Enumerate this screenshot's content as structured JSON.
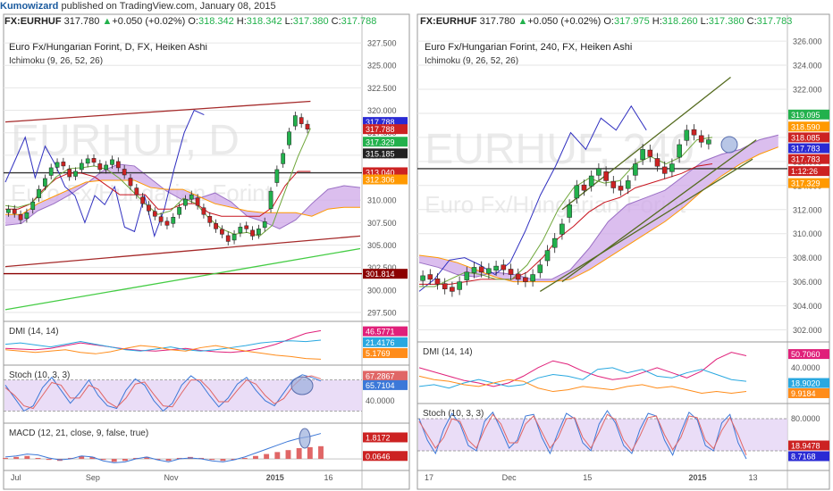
{
  "header": {
    "author": "Kumowizard",
    "published_text": "published on TradingView.com, January 08, 2015"
  },
  "colors": {
    "up": "#22b14c",
    "down": "#cc2222",
    "grid": "#e6e6e6",
    "cloud": "#cfa8e8",
    "tenkan": "#2a2ad4",
    "kijun": "#c8141e",
    "chikou": "#3030c0",
    "span_b": "#ff9900",
    "channel_dark": "#a52a2a",
    "channel_olive": "#556b1f",
    "channel_green": "#44cc44",
    "dmi_plus": "#29a8e0",
    "dmi_minus": "#ff8c1a",
    "adx": "#e0207a",
    "stoch_k": "#3c78d8",
    "stoch_d": "#e06666",
    "stoch_band": "#e5d5f5",
    "macd_hist": "#e06666",
    "macd_line": "#3c78d8",
    "highlight_circle": "#9aaedc"
  },
  "chart_data": [
    {
      "type": "candlestick",
      "panel": "left",
      "symbol": "FX:EURHUF",
      "ohlc_line": {
        "last": "317.780",
        "change": "+0.050 (+0.02%)",
        "O": "318.342",
        "H": "318.342",
        "L": "317.380",
        "C": "317.788"
      },
      "title": "Euro Fx/Hungarian Forint, D, FX, Heiken Ashi",
      "indicator": "Ichimoku (9, 26, 52, 26)",
      "watermark": "EURHUF, D",
      "watermark_sub": "Euro Fx/Hungarian Forint",
      "y_ticks": [
        "327.500",
        "325.000",
        "322.500",
        "320.000",
        "317.500",
        "315.000",
        "312.500",
        "310.000",
        "307.500",
        "305.000",
        "302.500",
        "300.000",
        "297.500"
      ],
      "ylim": [
        296.5,
        328.5
      ],
      "x_ticks": [
        "Jul",
        "Sep",
        "Nov",
        "2015",
        "16"
      ],
      "price_labels": [
        {
          "text": "317.788",
          "value": 318.7,
          "color": "#2a2ad4"
        },
        {
          "text": "317.788",
          "value": 317.9,
          "color": "#cc2222"
        },
        {
          "text": "317.329",
          "value": 316.5,
          "color": "#22b14c"
        },
        {
          "text": "315.185",
          "value": 315.2,
          "color": "#222222"
        },
        {
          "text": "313.040",
          "value": 313.1,
          "color": "#cc2222"
        },
        {
          "text": "312.306",
          "value": 312.3,
          "color": "#ff9900"
        },
        {
          "text": "301.814",
          "value": 301.8,
          "color": "#8b0000"
        }
      ],
      "horizontal_lines": [
        {
          "value": 313.04,
          "color": "#333333"
        },
        {
          "value": 301.81,
          "color": "#8b0000"
        }
      ],
      "channel_lines": [
        {
          "x1": 0.0,
          "y1": 318.7,
          "x2": 0.86,
          "y2": 321.0,
          "color": "#a52a2a"
        },
        {
          "x1": 0.0,
          "y1": 302.6,
          "x2": 1.0,
          "y2": 306.0,
          "color": "#a52a2a"
        },
        {
          "x1": 0.0,
          "y1": 297.8,
          "x2": 1.0,
          "y2": 304.6,
          "color": "#44cc44"
        }
      ],
      "close_series": [
        309,
        308.5,
        307.8,
        308.6,
        309.8,
        311.2,
        312.4,
        313.6,
        314.2,
        313.8,
        312.6,
        313.2,
        314.1,
        314.6,
        314.2,
        313.4,
        313.9,
        314.5,
        313.6,
        312.8,
        311.6,
        310.6,
        309.6,
        308.8,
        308.2,
        307.6,
        307.2,
        308.1,
        309.2,
        310.1,
        310.6,
        309.4,
        308.4,
        307.5,
        306.8,
        306.2,
        305.4,
        306.2,
        307.0,
        306.8,
        306.0,
        306.8,
        307.6,
        311.0,
        313.4,
        315.2,
        317.6,
        319.4,
        318.5,
        317.9
      ],
      "x_end": 0.86,
      "tenkan": [
        309.4,
        309.2,
        309.6,
        311.0,
        312.6,
        313.5,
        313.6,
        313.8,
        313.4,
        312.4,
        311.0,
        309.6,
        308.4,
        308.8,
        310.2,
        309.6,
        308.0,
        306.8,
        306.2,
        306.4,
        306.0,
        307.2,
        311.0,
        314.8,
        318.0
      ],
      "kijun": [
        309.0,
        309.0,
        309.6,
        311.2,
        312.4,
        313.0,
        313.0,
        312.6,
        311.6,
        310.6,
        310.6,
        310.6,
        309.0,
        309.0,
        309.6,
        309.6,
        308.6,
        308.2,
        308.2,
        308.2,
        308.2,
        309.2,
        311.6,
        313.2,
        313.2
      ],
      "chikou": [
        312.0,
        314.5,
        317.0,
        312.5,
        316.0,
        314.0,
        311.5,
        310.5,
        307.5,
        310.5,
        309.5,
        311.5,
        307.0,
        306.5,
        310.5,
        306.0,
        309.0,
        313.5,
        317.5,
        320.0,
        319.5
      ],
      "chikou_x_end": 0.56,
      "cloud_a": [
        307.2,
        307.4,
        308.8,
        309.6,
        310.6,
        311.8,
        313.2,
        314.0,
        313.8,
        312.4,
        311.0,
        310.0,
        310.2,
        310.8,
        309.8,
        308.2,
        307.6,
        306.8,
        307.8,
        309.6,
        311.2,
        311.6,
        311.4
      ],
      "cloud_b": [
        308.4,
        308.4,
        309.6,
        310.4,
        311.2,
        312.0,
        312.2,
        312.2,
        312.2,
        311.4,
        311.2,
        311.2,
        310.4,
        309.6,
        309.2,
        308.8,
        308.6,
        308.6,
        308.6,
        308.2,
        309.0,
        309.2,
        309.2
      ],
      "cloud_x_start": 0.0,
      "cloud_x_end": 1.0
    },
    {
      "type": "line",
      "panel": "left",
      "title": "DMI (14, 14)",
      "series": [
        {
          "name": "ADX",
          "values": [
            22,
            21,
            20,
            22,
            26,
            30,
            27,
            24,
            21,
            19,
            18,
            20,
            22,
            19,
            17,
            16,
            18,
            22,
            28,
            36,
            44,
            48
          ],
          "color": "#e0207a"
        },
        {
          "name": "+DI",
          "values": [
            28,
            30,
            27,
            24,
            28,
            32,
            28,
            24,
            20,
            18,
            21,
            24,
            20,
            18,
            20,
            23,
            26,
            30,
            32,
            33,
            32,
            34
          ],
          "color": "#29a8e0"
        },
        {
          "name": "-DI",
          "values": [
            20,
            18,
            16,
            18,
            20,
            16,
            14,
            17,
            22,
            26,
            24,
            20,
            18,
            23,
            26,
            22,
            18,
            15,
            12,
            10,
            7,
            6
          ],
          "color": "#ff8c1a"
        }
      ],
      "ylim": [
        0,
        55
      ],
      "value_labels": [
        {
          "text": "46.5771",
          "value": 47,
          "color": "#e0207a"
        },
        {
          "text": "21.4176",
          "value": 31,
          "color": "#29a8e0"
        },
        {
          "text": "5.1769",
          "value": 15,
          "color": "#ff8c1a"
        }
      ]
    },
    {
      "type": "line",
      "panel": "left",
      "title": "Stoch (10, 3, 3)",
      "y_ticks": [
        "40.0000"
      ],
      "series": [
        {
          "name": "%K",
          "values": [
            70,
            45,
            20,
            30,
            65,
            85,
            60,
            35,
            55,
            80,
            50,
            30,
            25,
            60,
            82,
            70,
            40,
            20,
            35,
            70,
            88,
            75,
            50,
            28,
            45,
            72,
            85,
            60,
            40,
            30,
            55,
            80,
            90,
            85,
            78
          ],
          "color": "#3c78d8"
        },
        {
          "name": "%D",
          "values": [
            65,
            50,
            30,
            25,
            50,
            75,
            70,
            45,
            45,
            70,
            62,
            38,
            27,
            45,
            72,
            76,
            52,
            30,
            28,
            55,
            80,
            80,
            62,
            38,
            38,
            60,
            80,
            72,
            50,
            34,
            44,
            68,
            85,
            88,
            82
          ],
          "color": "#e06666"
        }
      ],
      "ylim": [
        0,
        100
      ],
      "band": [
        20,
        80
      ],
      "value_labels": [
        {
          "text": "67.2867",
          "value": 88,
          "color": "#e06666"
        },
        {
          "text": "65.7104",
          "value": 70,
          "color": "#3c78d8"
        }
      ]
    },
    {
      "type": "bar",
      "panel": "left",
      "title": "MACD (12, 21, close, 9, false, true)",
      "histogram": [
        0.1,
        0.2,
        0.3,
        0.1,
        -0.1,
        -0.2,
        0.1,
        0.3,
        0.2,
        -0.1,
        -0.3,
        -0.2,
        0.1,
        0.2,
        -0.1,
        -0.2,
        0.1,
        0.2,
        0.1,
        -0.1,
        -0.2,
        -0.1,
        0.1,
        0.3,
        0.5,
        0.7,
        0.9,
        1.1,
        1.2,
        1.3
      ],
      "macd": [
        0.2,
        0.3,
        0.5,
        0.4,
        0.1,
        -0.1,
        0.0,
        0.3,
        0.2,
        -0.2,
        -0.4,
        -0.3,
        0.0,
        0.2,
        -0.1,
        -0.3,
        0.0,
        0.1,
        0.0,
        -0.2,
        -0.3,
        -0.1,
        0.2,
        0.6,
        1.0,
        1.4,
        1.8,
        2.1,
        2.3,
        2.6
      ],
      "ylim": [
        -1.0,
        3.2
      ],
      "value_labels": [
        {
          "text": "1.8172",
          "value": 2.2,
          "color": "#cc2222"
        },
        {
          "text": "0.0646",
          "value": 0.3,
          "color": "#cc2222"
        }
      ]
    },
    {
      "type": "candlestick",
      "panel": "right",
      "symbol": "FX:EURHUF",
      "ohlc_line": {
        "last": "317.780",
        "change": "+0.050 (+0.02%)",
        "O": "317.975",
        "H": "318.260",
        "L": "317.380",
        "C": "317.783"
      },
      "title": "Euro Fx/Hungarian Forint, 240, FX, Heiken Ashi",
      "indicator": "Ichimoku (9, 26, 52, 26)",
      "watermark": "EURHUF, 240",
      "watermark_sub": "Euro Fx/Hungarian Forint",
      "y_ticks": [
        "326.000",
        "324.000",
        "322.000",
        "320.000",
        "318.000",
        "316.000",
        "314.000",
        "312.000",
        "310.000",
        "308.000",
        "306.000",
        "304.000",
        "302.000"
      ],
      "ylim": [
        301.0,
        326.6
      ],
      "x_ticks": [
        "17",
        "Dec",
        "15",
        "2015",
        "13"
      ],
      "price_labels": [
        {
          "text": "319.095",
          "value": 319.9,
          "color": "#22b14c"
        },
        {
          "text": "318.590",
          "value": 318.9,
          "color": "#ff9900"
        },
        {
          "text": "318.085",
          "value": 318.0,
          "color": "#cc2222"
        },
        {
          "text": "317.783",
          "value": 317.1,
          "color": "#2a2ad4"
        },
        {
          "text": "317.783",
          "value": 316.2,
          "color": "#cc2222"
        },
        {
          "text": "1:12:26",
          "value": 315.2,
          "color": "#cc2222"
        },
        {
          "text": "317.329",
          "value": 314.2,
          "color": "#ff9900"
        }
      ],
      "horizontal_lines": [
        {
          "value": 315.4,
          "color": "#333333"
        }
      ],
      "channel_lines": [
        {
          "x1": 0.39,
          "y1": 312.0,
          "x2": 0.85,
          "y2": 323.0,
          "color": "#556b1f"
        },
        {
          "x1": 0.39,
          "y1": 306.0,
          "x2": 0.92,
          "y2": 317.8,
          "color": "#556b1f"
        },
        {
          "x1": 0.33,
          "y1": 305.2,
          "x2": 0.91,
          "y2": 316.2,
          "color": "#556b1f"
        }
      ],
      "close_series": [
        306.5,
        306.2,
        305.8,
        305.4,
        305.2,
        306.0,
        306.8,
        307.2,
        306.8,
        307.1,
        307.3,
        307.0,
        306.6,
        306.2,
        306.0,
        306.6,
        307.4,
        308.6,
        309.6,
        310.8,
        312.4,
        314.0,
        313.6,
        314.8,
        315.4,
        314.4,
        313.8,
        313.6,
        314.4,
        315.8,
        317.0,
        316.4,
        315.6,
        315.0,
        315.8,
        317.4,
        318.6,
        318.2,
        317.6,
        317.8
      ],
      "x_end": 0.8,
      "tenkan": [
        305.6,
        305.6,
        306.2,
        306.8,
        306.6,
        306.2,
        306.2,
        307.4,
        309.4,
        312.0,
        313.8,
        314.6,
        314.2,
        314.4,
        315.8,
        316.4,
        315.8,
        316.4,
        317.8,
        318.0
      ],
      "kijun": [
        305.8,
        305.8,
        305.8,
        306.0,
        306.2,
        306.2,
        306.2,
        306.8,
        308.0,
        309.6,
        310.6,
        311.8,
        312.6,
        313.0,
        313.8,
        314.2,
        314.6,
        315.0,
        315.6,
        315.8
      ],
      "chikou": [
        305.2,
        306.2,
        307.8,
        308.0,
        307.4,
        306.6,
        307.6,
        310.2,
        313.2,
        315.6,
        318.4,
        317.0,
        319.6,
        318.6,
        320.6,
        318.6
      ],
      "chikou_x_end": 0.62,
      "cloud_a": [
        307.6,
        307.2,
        306.6,
        306.4,
        306.8,
        306.6,
        306.2,
        306.2,
        307.0,
        308.8,
        311.0,
        312.4,
        313.0,
        313.6,
        314.8,
        316.0,
        316.6,
        317.0,
        317.8,
        318.2
      ],
      "cloud_b": [
        308.2,
        308.0,
        307.6,
        307.0,
        306.4,
        306.0,
        306.0,
        306.0,
        306.2,
        307.0,
        308.0,
        309.0,
        310.0,
        311.0,
        312.2,
        313.6,
        314.8,
        315.8,
        316.6,
        317.2
      ],
      "cloud_x_start": 0.0,
      "cloud_x_end": 0.98
    },
    {
      "type": "line",
      "panel": "right",
      "title": "DMI (14, 14)",
      "y_ticks": [
        "40.0000"
      ],
      "series": [
        {
          "name": "ADX",
          "values": [
            40,
            35,
            30,
            25,
            22,
            18,
            22,
            30,
            40,
            48,
            44,
            36,
            30,
            26,
            28,
            34,
            40,
            34,
            28,
            36,
            50,
            58,
            54
          ],
          "color": "#e0207a"
        },
        {
          "name": "+DI",
          "values": [
            18,
            20,
            16,
            22,
            26,
            22,
            18,
            20,
            28,
            32,
            30,
            26,
            38,
            40,
            34,
            38,
            30,
            28,
            34,
            38,
            32,
            26,
            24
          ],
          "color": "#29a8e0"
        },
        {
          "name": "-DI",
          "values": [
            30,
            26,
            24,
            20,
            18,
            22,
            26,
            24,
            16,
            12,
            14,
            18,
            16,
            14,
            18,
            20,
            16,
            18,
            14,
            10,
            12,
            10,
            12
          ],
          "color": "#ff8c1a"
        }
      ],
      "ylim": [
        0,
        65
      ],
      "value_labels": [
        {
          "text": "50.7060",
          "value": 56,
          "color": "#e0207a"
        },
        {
          "text": "18.9020",
          "value": 22,
          "color": "#29a8e0"
        },
        {
          "text": "9.9184",
          "value": 10,
          "color": "#ff8c1a"
        }
      ]
    },
    {
      "type": "line",
      "panel": "right",
      "title": "Stoch (10, 3, 3)",
      "y_ticks": [
        "80.0000"
      ],
      "series": [
        {
          "name": "%K",
          "values": [
            80,
            40,
            15,
            60,
            90,
            70,
            30,
            20,
            75,
            92,
            60,
            25,
            40,
            85,
            88,
            45,
            15,
            55,
            90,
            80,
            35,
            20,
            70,
            95,
            72,
            30,
            15,
            60,
            90,
            85,
            40,
            12,
            55,
            92,
            78,
            30,
            20,
            72,
            88,
            35,
            5
          ],
          "color": "#3c78d8"
        },
        {
          "name": "%D",
          "values": [
            75,
            50,
            25,
            45,
            80,
            75,
            40,
            25,
            60,
            88,
            70,
            35,
            35,
            70,
            85,
            55,
            25,
            45,
            80,
            82,
            45,
            25,
            55,
            88,
            78,
            40,
            20,
            48,
            82,
            85,
            50,
            22,
            45,
            85,
            82,
            40,
            24,
            58,
            82,
            50,
            12
          ],
          "color": "#e06666"
        }
      ],
      "ylim": [
        0,
        100
      ],
      "band": [
        20,
        80
      ],
      "value_labels": [
        {
          "text": "18.9478",
          "value": 30,
          "color": "#cc2222"
        },
        {
          "text": "8.7168",
          "value": 10,
          "color": "#2a2ad4"
        }
      ]
    }
  ]
}
